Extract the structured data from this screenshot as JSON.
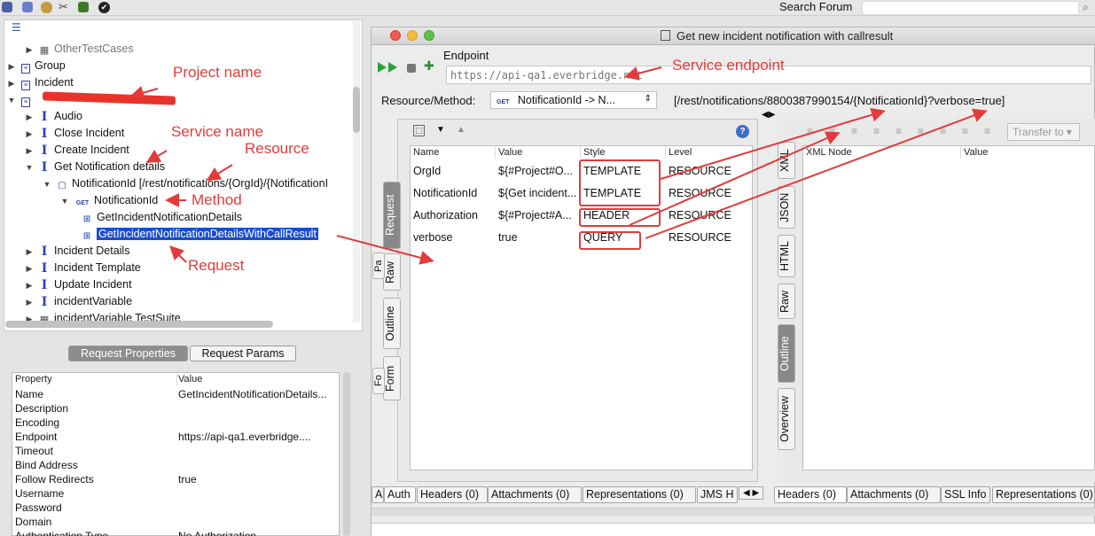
{
  "topbar": {
    "search_label": "Search Forum",
    "icons": [
      "save-icon",
      "copy-icon",
      "people-icon",
      "tools-icon",
      "android-icon",
      "ok-circle-icon"
    ],
    "search_icon": "magnifier-icon"
  },
  "navigator": {
    "tree": [
      {
        "label": "OtherTestCases",
        "type": "suite",
        "depth": 1,
        "expanded": false,
        "faded": true
      },
      {
        "label": "Group",
        "type": "project",
        "depth": 0,
        "expanded": false
      },
      {
        "label": "Incident",
        "type": "project",
        "depth": 0,
        "expanded": false
      },
      {
        "label": "",
        "type": "project",
        "depth": 0,
        "expanded": true,
        "redacted": true
      },
      {
        "label": "Audio",
        "type": "service",
        "depth": 1,
        "expanded": false
      },
      {
        "label": "Close Incident",
        "type": "service",
        "depth": 1,
        "expanded": false
      },
      {
        "label": "Create Incident",
        "type": "service",
        "depth": 1,
        "expanded": false
      },
      {
        "label": "Get Notification details",
        "type": "service",
        "depth": 1,
        "expanded": true
      },
      {
        "label": "NotificationId [/rest/notifications/{OrgId}/{NotificationI",
        "type": "resource",
        "depth": 2,
        "expanded": true
      },
      {
        "label": "NotificationId",
        "type": "method",
        "depth": 3,
        "expanded": true
      },
      {
        "label": "GetIncidentNotificationDetails",
        "type": "request",
        "depth": 4
      },
      {
        "label": "GetIncidentNotificationDetailsWithCallResult",
        "type": "request",
        "depth": 4,
        "selected": true
      },
      {
        "label": "Incident Details",
        "type": "service",
        "depth": 1,
        "expanded": false
      },
      {
        "label": "Incident Template",
        "type": "service",
        "depth": 1,
        "expanded": false
      },
      {
        "label": "Update Incident",
        "type": "service",
        "depth": 1,
        "expanded": false
      },
      {
        "label": "incidentVariable",
        "type": "service",
        "depth": 1,
        "expanded": false
      },
      {
        "label": "incidentVariable TestSuite",
        "type": "suite",
        "depth": 1,
        "expanded": false
      }
    ]
  },
  "properties": {
    "tabs": [
      "Request Properties",
      "Request Params"
    ],
    "active_tab": "Request Properties",
    "headers": [
      "Property",
      "Value"
    ],
    "rows": [
      [
        "Name",
        "GetIncidentNotificationDetails..."
      ],
      [
        "Description",
        ""
      ],
      [
        "Encoding",
        ""
      ],
      [
        "Endpoint",
        "https://api-qa1.everbridge...."
      ],
      [
        "Timeout",
        ""
      ],
      [
        "Bind Address",
        ""
      ],
      [
        "Follow Redirects",
        "true"
      ],
      [
        "Username",
        ""
      ],
      [
        "Password",
        ""
      ],
      [
        "Domain",
        ""
      ],
      [
        "Authentication Type",
        "No Authorization"
      ]
    ]
  },
  "editor": {
    "title": "Get new incident notification with callresult",
    "endpoint_label": "Endpoint",
    "endpoint_value": "https://api-qa1.everbridge.net",
    "resmeth_label": "Resource/Method:",
    "method_badge": "GET",
    "resmeth_value": "NotificationId -> N...",
    "resource_path": "[/rest/notifications/8800387990154/{NotificationId}?verbose=true]",
    "params_headers": [
      "Name",
      "Value",
      "Style",
      "Level"
    ],
    "params": [
      {
        "name": "OrgId",
        "value": "${#Project#O...",
        "style": "TEMPLATE",
        "level": "RESOURCE"
      },
      {
        "name": "NotificationId",
        "value": "${Get incident...",
        "style": "TEMPLATE",
        "level": "RESOURCE"
      },
      {
        "name": "Authorization",
        "value": "${#Project#A...",
        "style": "HEADER",
        "level": "RESOURCE"
      },
      {
        "name": "verbose",
        "value": "true",
        "style": "QUERY",
        "level": "RESOURCE"
      }
    ],
    "left_vtabs": [
      "Request",
      "Raw",
      "Outline",
      "Form"
    ],
    "left_vtabs_partial": [
      "Pa",
      "Fo"
    ],
    "right_vtabs": [
      "XML",
      "JSON",
      "HTML",
      "Raw",
      "Outline",
      "Overview"
    ],
    "request_bottom_tabs": [
      "A",
      "Auth",
      "Headers (0)",
      "Attachments (0)",
      "Representations (0)",
      "JMS H"
    ],
    "response_bottom_tabs": [
      "Headers (0)",
      "Attachments (0)",
      "SSL Info",
      "Representations (0)"
    ],
    "transfer_label": "Transfer to",
    "resp_headers": [
      "XML Node",
      "Value"
    ]
  },
  "annotations": {
    "project_name": "Project name",
    "service_name": "Service name",
    "resource": "Resource",
    "method": "Method",
    "request": "Request",
    "service_endpoint": "Service endpoint"
  },
  "colors": {
    "annotation": "#e23b3b",
    "selection": "#1a4dcc",
    "tree_icon": "#2c3f9a"
  }
}
